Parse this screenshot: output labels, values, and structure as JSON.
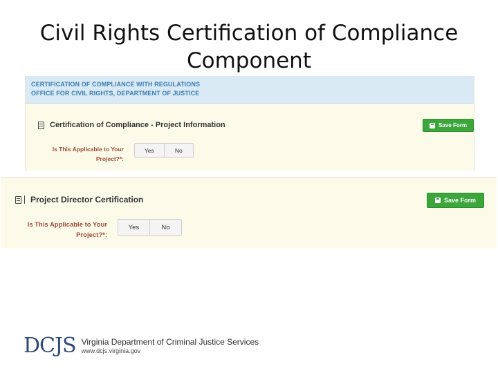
{
  "slide": {
    "title_line1": "Civil Rights Certification of Compliance",
    "title_line2": "Component"
  },
  "screenshot1": {
    "header_line1": "CERTIFICATION OF COMPLIANCE WITH REGULATIONS",
    "header_line2": "OFFICE FOR CIVIL RIGHTS, DEPARTMENT OF JUSTICE",
    "panel_title": "Certification of Compliance - Project Information",
    "save_label": "Save Form",
    "question_line1": "Is This Applicable to Your",
    "question_line2": "Project?*:",
    "options": [
      "Yes",
      "No"
    ]
  },
  "screenshot2": {
    "panel_title": "Project Director Certification",
    "save_label": "Save Form",
    "question_line1": "Is This Applicable to Your",
    "question_line2": "Project?*:",
    "options": [
      "Yes",
      "No"
    ]
  },
  "footer": {
    "logo_mark": "DCJS",
    "org_name": "Virginia Department of Criminal Justice Services",
    "url": "www.dcjs.virginia.gov"
  },
  "icons": {
    "panel": "document-icon",
    "save": "save-disk-icon"
  },
  "colors": {
    "save_button": "#3ca53c",
    "header_band": "#d9eaf5",
    "header_text": "#3a7cb2",
    "panel_background": "#fcfbea",
    "question_label": "#a04a3a",
    "logo": "#2d4a77"
  }
}
